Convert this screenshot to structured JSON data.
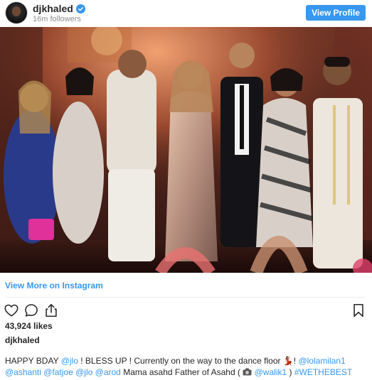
{
  "header": {
    "username": "djkhaled",
    "followers": "16m followers",
    "view_profile_label": "View Profile"
  },
  "colors": {
    "accent": "#3897f0",
    "text": "#262626",
    "muted": "#8e8e8e"
  },
  "icons": [
    "verified-badge-icon",
    "heart-icon",
    "comment-icon",
    "share-icon",
    "bookmark-icon",
    "camera-icon"
  ],
  "post": {
    "view_more_label": "View More on Instagram",
    "likes": "43,924 likes",
    "caption_username": "djkhaled",
    "caption": {
      "t1": "HAPPY BDAY ",
      "m1": "@jlo",
      "t2": " ! BLESS UP ! Currently on the way to the dance floor ",
      "emoji1": "💃🏽",
      "t3": "! ",
      "m2": "@lolamilan1",
      "m3": "@ashanti",
      "m4": "@fatjoe",
      "m5": "@jlo",
      "m6": "@arod",
      "t4": " Mama asahd Father of Asahd ( ",
      "m7": "@walik1",
      "t5": " ) ",
      "m8": "#WETHEBEST"
    }
  }
}
